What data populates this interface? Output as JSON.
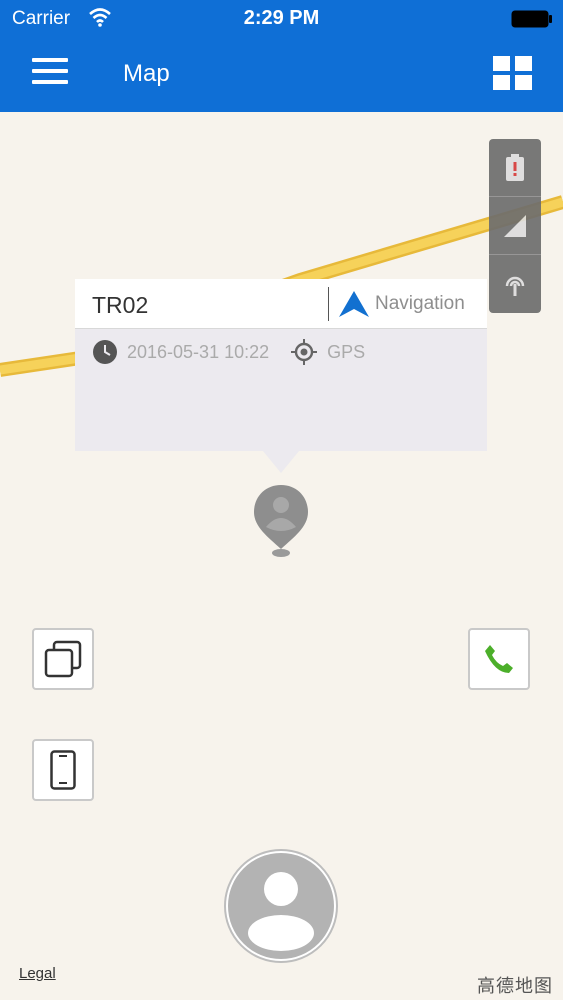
{
  "status_bar": {
    "carrier": "Carrier",
    "time": "2:29 PM"
  },
  "header": {
    "title": "Map",
    "menu_icon": "hamburger-menu-icon",
    "view_icon": "grid-view-icon"
  },
  "colors": {
    "primary": "#0f6fd6",
    "road": "#f5c542",
    "map_bg": "#f7f3ec",
    "call_green": "#4caf2a"
  },
  "map_toolbar": {
    "icons": [
      "battery-alert-icon",
      "signal-strength-icon",
      "antenna-icon"
    ]
  },
  "device_popup": {
    "device_name": "TR02",
    "navigation_label": "Navigation",
    "timestamp": "2016-05-31 10:22",
    "location_source": "GPS"
  },
  "footer": {
    "legal": "Legal",
    "map_brand": "高德地图"
  }
}
